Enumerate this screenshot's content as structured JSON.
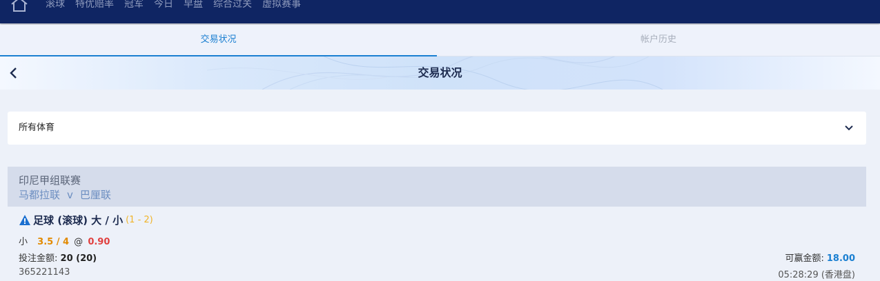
{
  "nav": {
    "items": [
      "滚球",
      "特优赔率",
      "冠军",
      "今日",
      "早盘",
      "综合过关",
      "虚拟赛事"
    ]
  },
  "tabs": [
    {
      "label": "交易状况",
      "active": true
    },
    {
      "label": "帐户历史",
      "active": false
    }
  ],
  "header": {
    "title": "交易状况"
  },
  "filter": {
    "selected": "所有体育"
  },
  "league": {
    "name": "印尼甲组联赛",
    "home": "马都拉联",
    "vs": "v",
    "away": "巴厘联"
  },
  "bet": {
    "title": "足球 (滚球) 大 / 小",
    "score": "(1 - 2)",
    "selection": "小",
    "handicap": "3.5 / 4",
    "at": "@",
    "odds": "0.90",
    "stake_label": "投注金额:",
    "stake_value": "20 (20)",
    "win_label": "可赢金额:",
    "win_value": "18.00",
    "bet_id": "365221143",
    "time": "05:28:29 (香港盘)"
  },
  "colors": {
    "nav_bg": "#0f2563",
    "accent": "#1a7fd1",
    "handicap": "#e28a00",
    "odds": "#e0403f",
    "score": "#f0b429",
    "league_bg": "#d5dceb"
  },
  "icons": {
    "home": "home-icon",
    "back": "chevron-left-icon",
    "dropdown": "chevron-down-icon",
    "warning": "warning-icon"
  }
}
